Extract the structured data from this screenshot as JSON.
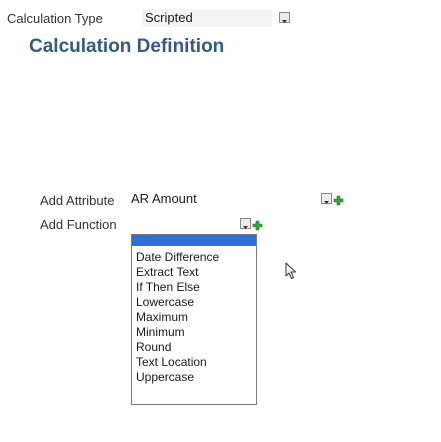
{
  "calc_type": {
    "label": "Calculation Type",
    "value": "Scripted"
  },
  "heading": "Calculation Definition",
  "add_attribute": {
    "label": "Add Attribute",
    "value": "AR Amount"
  },
  "add_function": {
    "label": "Add Function",
    "options": [
      "Date Difference",
      "Extract Text",
      "If Then Else",
      "Lowercase",
      "Maximum",
      "Minimum",
      "Round",
      "Text Location",
      "Uppercase"
    ]
  },
  "colors": {
    "heading": "#335a86",
    "list_header": "#2f6fd0",
    "plus": "#3aa33a"
  }
}
